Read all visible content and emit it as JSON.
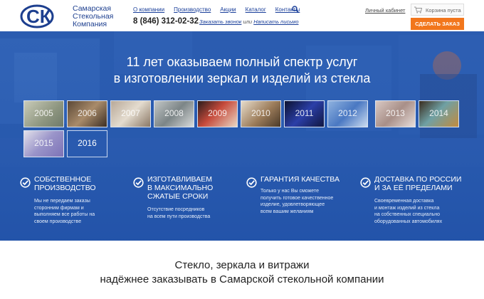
{
  "header": {
    "logo_letters": "СК",
    "logo_lines": [
      "Самарская",
      "Стекольная",
      "Компания"
    ],
    "nav": [
      "О компании",
      "Производство",
      "Акции",
      "Каталог",
      "Контакты"
    ],
    "phone": "8 (846) 312-02-32",
    "callback_link": "Заказать звонок",
    "callback_or": "или",
    "letter_link": "Написать письмо",
    "cabinet": "Личный кабинет",
    "cart": "Корзина пуста",
    "order_button": "СДЕЛАТЬ ЗАКАЗ"
  },
  "hero": {
    "title_lines": [
      "11 лет оказываем полный спектр услуг",
      "в изготовлении зеркал и изделий из стекла"
    ],
    "years": [
      "2005",
      "2006",
      "2007",
      "2008",
      "2009",
      "2010",
      "2011",
      "2012",
      "2013",
      "2014",
      "2015",
      "2016"
    ],
    "features": [
      {
        "title": "СОБСТВЕННОЕ\nПРОИЗВОДСТВО",
        "text": "Мы не передаем заказы\nсторонним  фирмам и\nвыполняем все работы на\nсвоем производстве"
      },
      {
        "title": "ИЗГОТАВЛИВАЕМ\nВ МАКСИМАЛЬНО\nСЖАТЫЕ СРОКИ",
        "text": "Отсутствие посредников\nна всем пути производства"
      },
      {
        "title": "ГАРАНТИЯ КАЧЕСТВА",
        "text": "Только у нас Вы сможете\nполучить готовое качественное\nизделие, удовлетворяющее\nвсем вашим желаниям"
      },
      {
        "title": "ДОСТАВКА ПО РОССИИ\nИ ЗА ЕЁ ПРЕДЕЛАМИ",
        "text": "Своевременная доставка\nи монтаж изделий из стекла\nна собственных специально\nоборудованных автомобилях"
      }
    ]
  },
  "bottom": {
    "title_lines": [
      "Стекло, зеркала и витражи",
      "надёжнее заказывать в Самарской стекольной компании"
    ]
  },
  "colors": {
    "brand_blue": "#1d3f8f",
    "hero_blue": "#2356ad",
    "order_orange": "#f2761c"
  }
}
